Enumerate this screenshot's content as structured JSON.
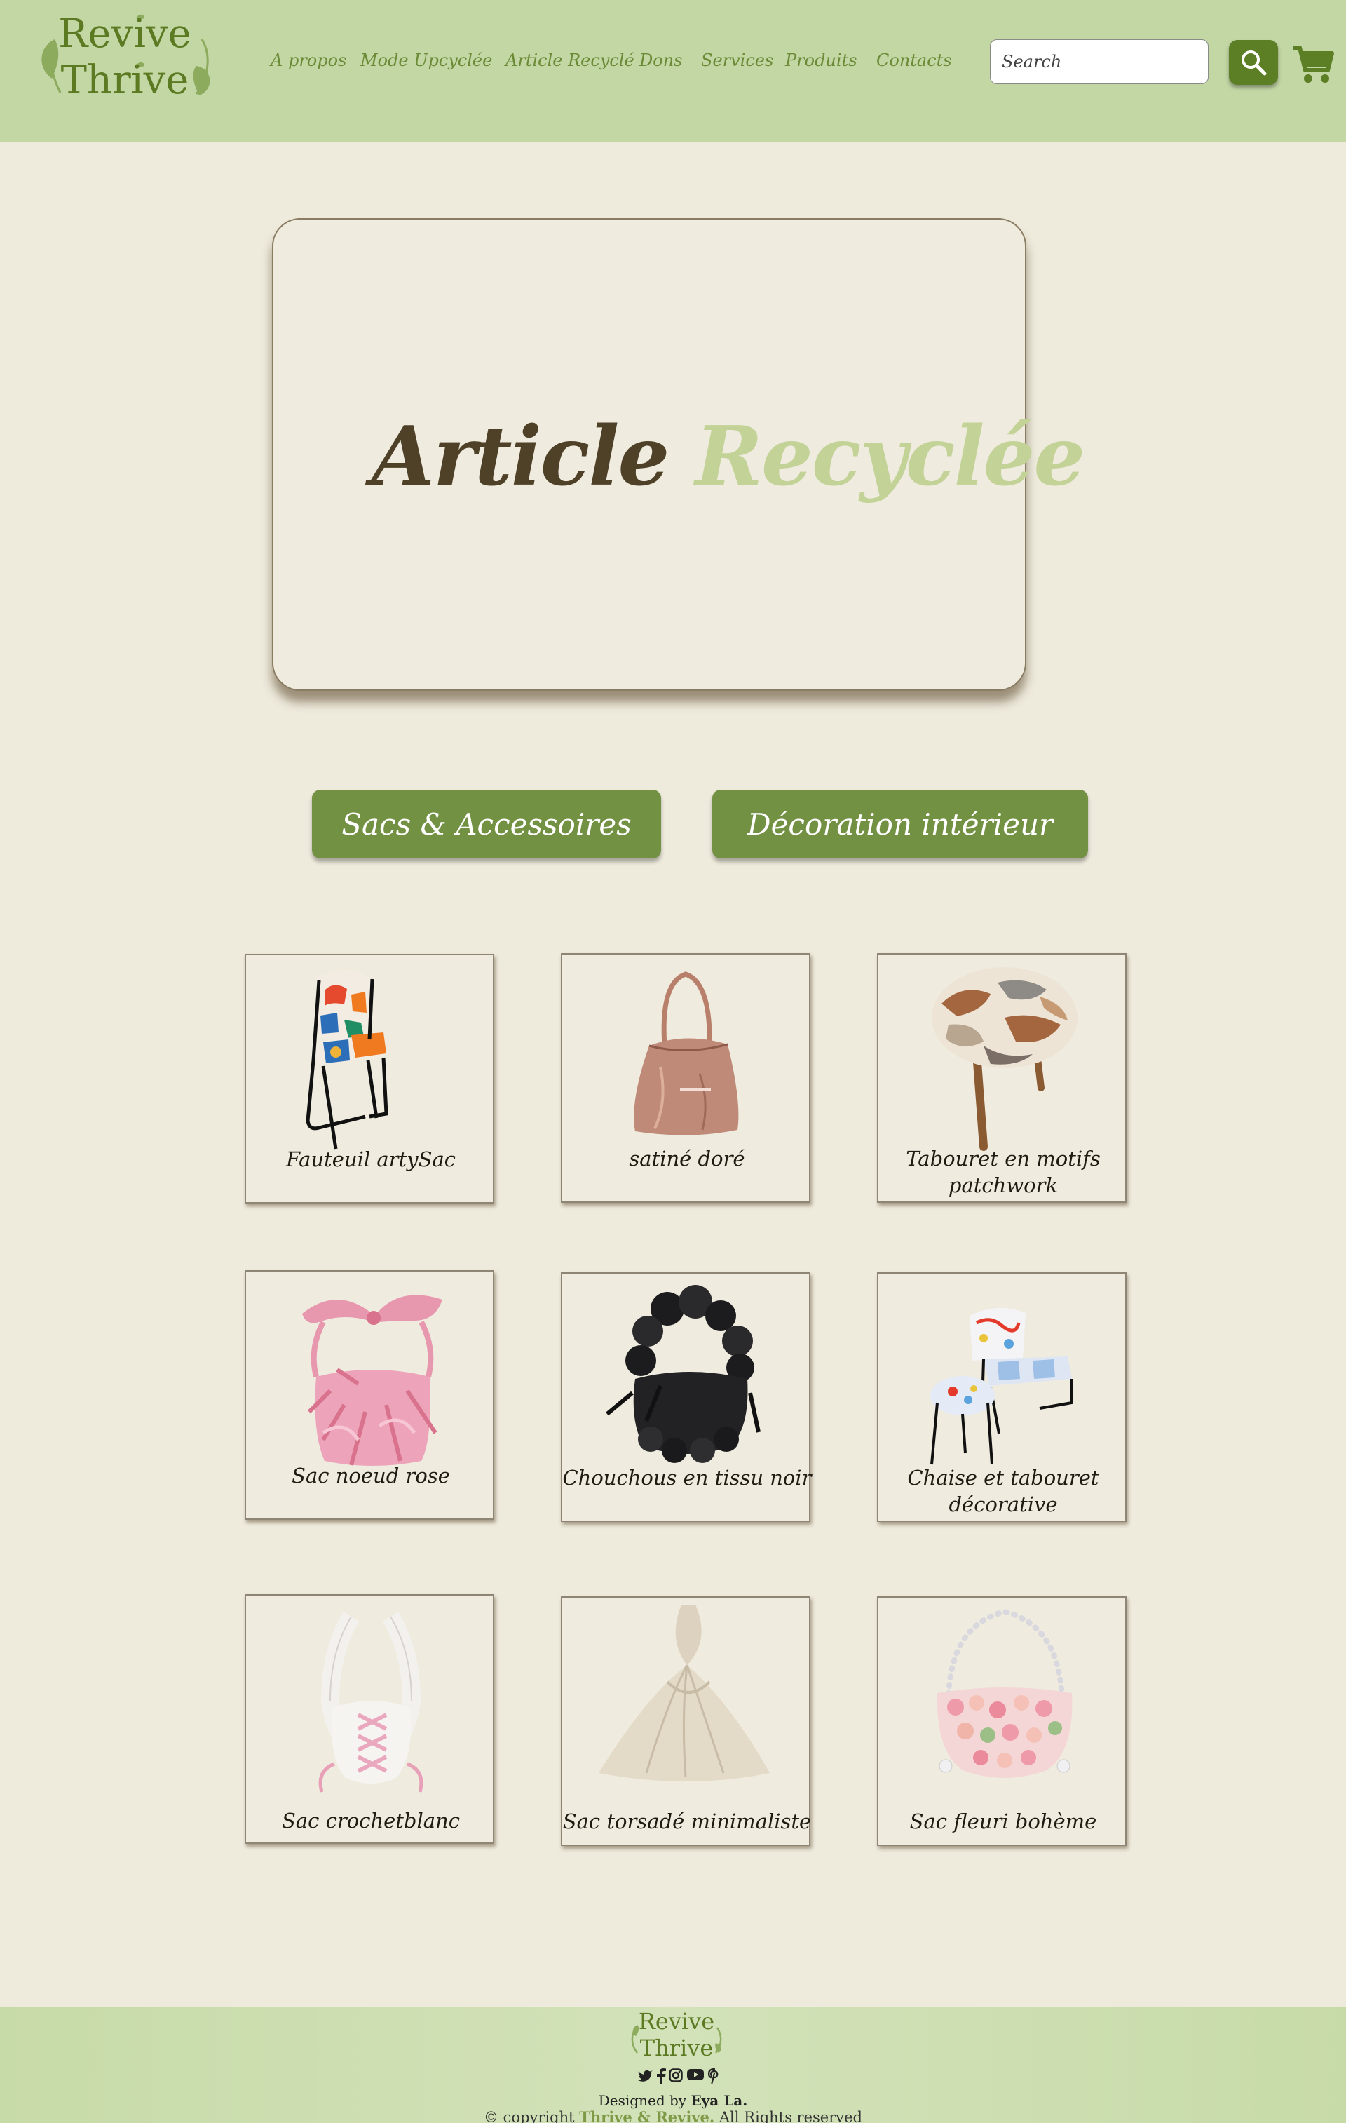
{
  "header": {
    "logo_line1": "Revive",
    "logo_line2": "Thrive",
    "nav": [
      "A propos",
      "Mode Upcyclée",
      "Article Recyclé",
      "Dons",
      "Services",
      "Produits",
      "Contacts"
    ],
    "search_placeholder": "Search",
    "search_icon": "search-icon",
    "cart_icon": "cart-icon"
  },
  "hero": {
    "title_part1": "Article",
    "title_part2": "Recyclée"
  },
  "categories": [
    "Sacs & Accessoires",
    "Décoration intérieur"
  ],
  "products": [
    {
      "label_l1": "Fauteuil artySac",
      "label_l2": ""
    },
    {
      "label_l1": "satiné doré",
      "label_l2": ""
    },
    {
      "label_l1": "Tabouret en motifs",
      "label_l2": "patchwork"
    },
    {
      "label_l1": "Sac noeud rose",
      "label_l2": ""
    },
    {
      "label_l1": "Chouchous en tissu noir",
      "label_l2": ""
    },
    {
      "label_l1": "Chaise et tabouret",
      "label_l2": "décorative"
    },
    {
      "label_l1": "Sac crochetblanc",
      "label_l2": ""
    },
    {
      "label_l1": "Sac torsadé minimaliste",
      "label_l2": ""
    },
    {
      "label_l1": "Sac fleuri bohème",
      "label_l2": ""
    }
  ],
  "footer": {
    "logo_line1": "Revive",
    "logo_line2": "Thrive",
    "social_icons": [
      "twitter-icon",
      "facebook-icon",
      "instagram-icon",
      "youtube-icon",
      "pinterest-icon"
    ],
    "designed_prefix": "Designed by",
    "designer": "Eya La.",
    "copy_prefix": "© copyright",
    "copy_brand": "Thrive & Revive.",
    "copy_suffix": "All Rights reserved"
  },
  "colors": {
    "header_bg": "#c3d7a5",
    "page_bg": "#eeeadc",
    "accent_green": "#5c7e25",
    "button_green": "#739143",
    "title_brown": "#4f4128",
    "title_green": "#c3d397"
  }
}
